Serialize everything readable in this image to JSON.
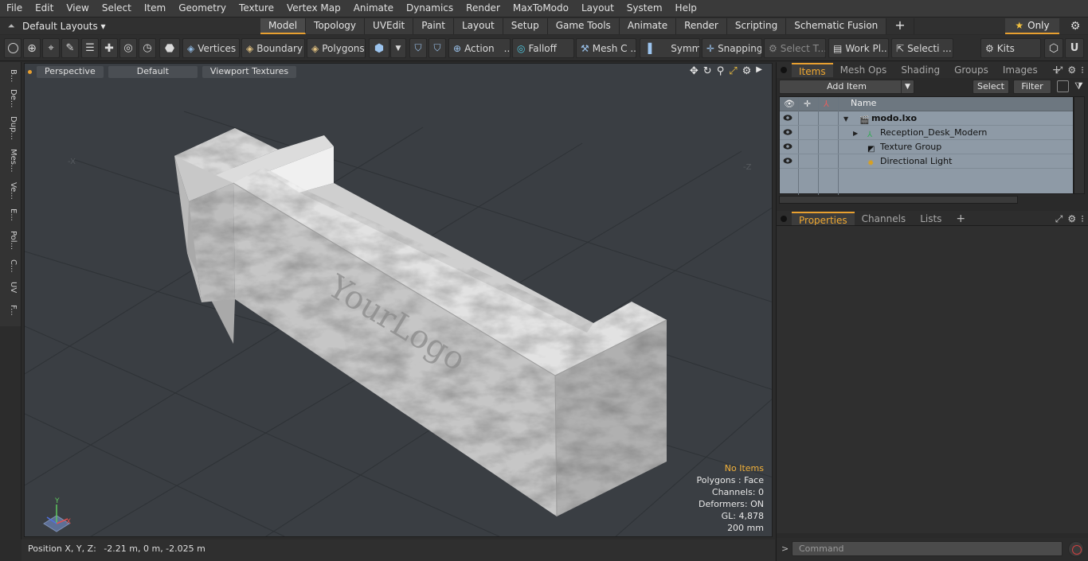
{
  "menu": [
    "File",
    "Edit",
    "View",
    "Select",
    "Item",
    "Geometry",
    "Texture",
    "Vertex Map",
    "Animate",
    "Dynamics",
    "Render",
    "MaxToModo",
    "Layout",
    "System",
    "Help"
  ],
  "layout_menu": {
    "label": "Default Layouts ▾"
  },
  "layout_tabs": [
    {
      "label": "Model",
      "active": true
    },
    {
      "label": "Topology"
    },
    {
      "label": "UVEdit"
    },
    {
      "label": "Paint"
    },
    {
      "label": "Layout"
    },
    {
      "label": "Setup"
    },
    {
      "label": "Game Tools"
    },
    {
      "label": "Animate"
    },
    {
      "label": "Render"
    },
    {
      "label": "Scripting"
    },
    {
      "label": "Schematic Fusion"
    },
    {
      "label": "+"
    }
  ],
  "only_button": "Only",
  "toolbar": {
    "vertices": "Vertices",
    "boundary": "Boundary",
    "polygons": "Polygons",
    "action": "Action",
    "action_dots": "...",
    "falloff": "Falloff",
    "mesh": "Mesh C ...",
    "symm": "Symm ...",
    "snapping": "Snapping",
    "select_t": "Select T...",
    "work_pl": "Work Pl...",
    "selecti": "Selecti ...",
    "kits": "Kits"
  },
  "left_tabs": [
    "B...",
    "De...",
    "Dup...",
    "Mes...",
    "Ve...",
    "E...",
    "Pol...",
    "C...",
    "UV",
    "F..."
  ],
  "viewport": {
    "view_mode": "Perspective",
    "shading": "Default",
    "textures": "Viewport Textures",
    "logo_text": "YourLogo",
    "axis_x": "X",
    "axis_y": "Y",
    "stats": {
      "items": "No Items",
      "polygons": "Polygons : Face",
      "channels": "Channels: 0",
      "deformers": "Deformers: ON",
      "gl": "GL: 4,878",
      "scale": "200 mm"
    }
  },
  "status": {
    "label": "Position X, Y, Z:",
    "value": "-2.21 m, 0 m, -2.025 m"
  },
  "items_panel": {
    "tabs": [
      {
        "label": "Items",
        "active": true
      },
      {
        "label": "Mesh Ops"
      },
      {
        "label": "Shading"
      },
      {
        "label": "Groups"
      },
      {
        "label": "Images"
      },
      {
        "label": "+"
      }
    ],
    "add_item": "Add Item",
    "select": "Select",
    "filter": "Filter",
    "column_name": "Name",
    "rows": [
      {
        "label": "modo.lxo",
        "icon": "scene-icon"
      },
      {
        "label": "Reception_Desk_Modern",
        "icon": "mesh-icon"
      },
      {
        "label": "Texture Group",
        "icon": "texture-group-icon"
      },
      {
        "label": "Directional Light",
        "icon": "light-icon"
      }
    ]
  },
  "properties_panel": {
    "tabs": [
      {
        "label": "Properties",
        "active": true
      },
      {
        "label": "Channels"
      },
      {
        "label": "Lists"
      },
      {
        "label": "+"
      }
    ]
  },
  "command": {
    "placeholder": "Command"
  },
  "colors": {
    "accent": "#e8a030",
    "viewport_bg": "#3a3e43",
    "items_bg": "#8e9aa6"
  }
}
